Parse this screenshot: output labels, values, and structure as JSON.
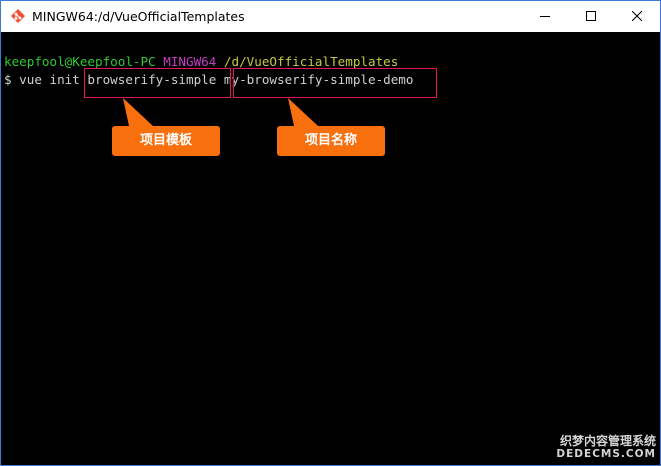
{
  "window": {
    "title": "MINGW64:/d/VueOfficialTemplates",
    "icon": "git-bash-icon",
    "controls": {
      "minimize": "minimize-icon",
      "maximize": "maximize-icon",
      "close": "close-icon"
    },
    "border_color": "#3a7ad9"
  },
  "terminal": {
    "prompt": {
      "user_host": "keepfool@Keepfool-PC",
      "env": "MINGW64",
      "path": "/d/VueOfficialTemplates"
    },
    "command": {
      "prefix": "$ vue init",
      "template": "browserify-simple",
      "project_name": "my-browserify-simple-demo"
    },
    "colors": {
      "user_host": "#32c832",
      "env": "#c33cc3",
      "path": "#c8c83c",
      "command": "#d0d0d0",
      "background": "#000000"
    }
  },
  "annotations": {
    "template_label": "项目模板",
    "project_name_label": "项目名称",
    "highlight_color": "#e0155a",
    "callout_color": "#f86f0d"
  },
  "watermark": {
    "line1": "织梦内容管理系统",
    "line2": "DEDECMS.COM"
  }
}
